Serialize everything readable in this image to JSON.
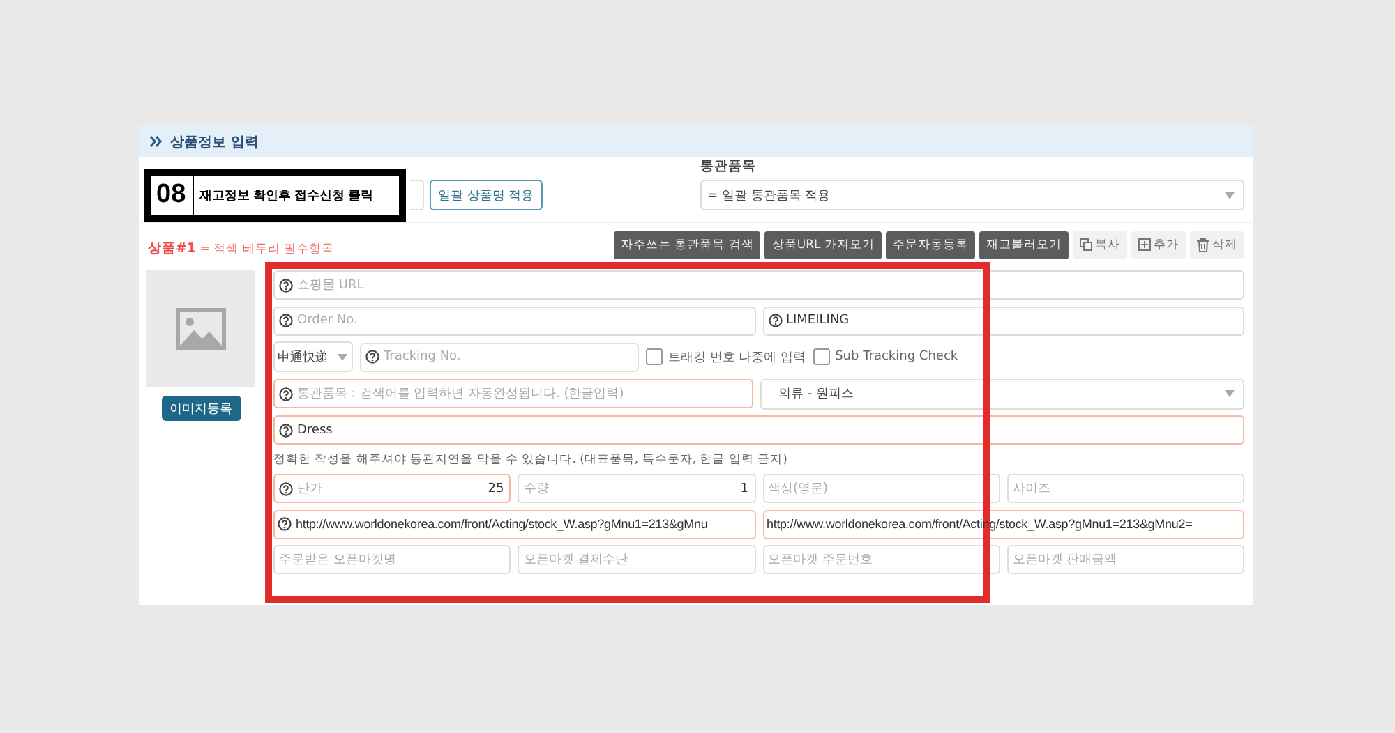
{
  "section_title": "상품정보 입력",
  "callout": {
    "number": "08",
    "text": "재고정보 확인후 접수신청 클릭"
  },
  "bulk_name_button": "일괄 상품명 적용",
  "customs": {
    "label": "통관품목",
    "value": "= 일괄 통관품목 적용"
  },
  "product": {
    "title": "상품#1",
    "note": " = 적색 테두리 필수항목"
  },
  "action_buttons": [
    {
      "label": "자주쓰는 통관품목 검색",
      "kind": "dark"
    },
    {
      "label": "상품URL 가져오기",
      "kind": "dark"
    },
    {
      "label": "주문자동등록",
      "kind": "dark"
    },
    {
      "label": "재고불러오기",
      "kind": "dark"
    },
    {
      "label": "복사",
      "kind": "copy"
    },
    {
      "label": "추가",
      "kind": "add"
    },
    {
      "label": "삭제",
      "kind": "delete"
    }
  ],
  "image_button": "이미지등록",
  "rows": [
    [
      {
        "kind": "field",
        "placeholder": "쇼핑몰 URL",
        "help": true,
        "required": false
      }
    ],
    [
      {
        "kind": "field",
        "placeholder": "Order No.",
        "help": true,
        "required": false
      },
      {
        "kind": "field",
        "value": "LIMEILING",
        "help": true,
        "required": false
      }
    ],
    [
      {
        "kind": "carrier",
        "value": "申通快递"
      },
      {
        "kind": "tracking",
        "placeholder": "Tracking No.",
        "help": true,
        "required": false
      },
      {
        "kind": "checkbox",
        "label": "트래킹 번호 나중에 입력",
        "checked": false
      },
      {
        "kind": "checkbox",
        "label": "Sub Tracking Check",
        "checked": false
      }
    ],
    [
      {
        "kind": "field",
        "placeholder": "통관품목 : 검색어를 입력하면 자동완성됩니다. (한글입력)",
        "help": true,
        "required": true
      },
      {
        "kind": "select",
        "value": "의류 - 원피스"
      }
    ],
    [
      {
        "kind": "field",
        "value": "Dress",
        "help": true,
        "required": true
      }
    ],
    [
      {
        "kind": "note",
        "text": "정확한 작성을 해주셔야 통관지연을 막을 수 있습니다. (대표품목, 특수문자, 한글 입력 금지)"
      }
    ],
    [
      {
        "kind": "field",
        "placeholder": "단가",
        "value": "25",
        "help": true,
        "required": true
      },
      {
        "kind": "field",
        "placeholder": "수량",
        "value": "1",
        "help": false,
        "required": false
      },
      {
        "kind": "field",
        "placeholder": "색상(영문)",
        "help": false,
        "required": false
      },
      {
        "kind": "field",
        "placeholder": "사이즈",
        "help": false,
        "required": false
      }
    ],
    [
      {
        "kind": "url",
        "value": "http://www.worldonekorea.com/front/Acting/stock_W.asp?gMnu1=213&gMnu",
        "help": true,
        "required": true
      },
      {
        "kind": "url",
        "value": "http://www.worldonekorea.com/front/Acting/stock_W.asp?gMnu1=213&gMnu2=",
        "help": false,
        "required": true
      }
    ],
    [
      {
        "kind": "field",
        "placeholder": "주문받은 오픈마켓명",
        "help": false,
        "required": false
      },
      {
        "kind": "field",
        "placeholder": "오픈마켓 결제수단",
        "help": false,
        "required": false
      },
      {
        "kind": "field",
        "placeholder": "오픈마켓 주문번호",
        "help": false,
        "required": false
      },
      {
        "kind": "field",
        "placeholder": "오픈마켓 판매금액",
        "help": false,
        "required": false
      }
    ]
  ]
}
